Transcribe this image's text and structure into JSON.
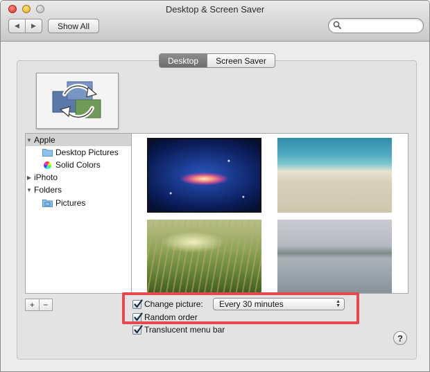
{
  "window": {
    "title": "Desktop & Screen Saver"
  },
  "toolbar": {
    "back_icon": "chevron-left-icon",
    "forward_icon": "chevron-right-icon",
    "show_all_label": "Show All",
    "search_value": "",
    "search_placeholder": ""
  },
  "tabs": [
    {
      "label": "Desktop",
      "selected": true
    },
    {
      "label": "Screen Saver",
      "selected": false
    }
  ],
  "sidebar": {
    "groups": [
      {
        "label": "Apple",
        "expanded": true,
        "selected": true,
        "items": [
          {
            "label": "Desktop Pictures",
            "icon": "folder-icon"
          },
          {
            "label": "Solid Colors",
            "icon": "color-wheel-icon"
          }
        ]
      },
      {
        "label": "iPhoto",
        "expanded": false,
        "items": []
      },
      {
        "label": "Folders",
        "expanded": true,
        "items": [
          {
            "label": "Pictures",
            "icon": "pictures-folder-icon"
          }
        ]
      }
    ]
  },
  "wallpapers": [
    {
      "name": "galaxy",
      "selected": true
    },
    {
      "name": "beach",
      "selected": false
    },
    {
      "name": "grass",
      "selected": false
    },
    {
      "name": "misty-lake",
      "selected": false
    }
  ],
  "options": {
    "change_picture_label": "Change picture:",
    "change_picture_checked": true,
    "interval_value": "Every 30 minutes",
    "random_order_label": "Random order",
    "random_order_checked": true,
    "translucent_label": "Translucent menu bar",
    "translucent_checked": true
  },
  "buttons": {
    "add_label": "+",
    "remove_label": "−",
    "help_label": "?"
  },
  "colors": {
    "highlight": "#e5484d",
    "selected_tab": "#7a7a7a"
  }
}
